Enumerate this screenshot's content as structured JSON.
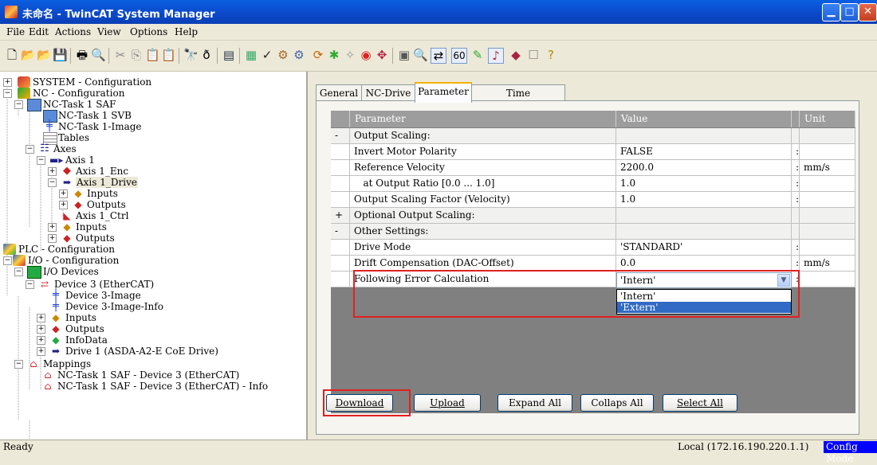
{
  "window": {
    "title": "未命名 - TwinCAT System Manager",
    "controls": {
      "minimize": "▁",
      "maximize": "□",
      "close": "✕"
    }
  },
  "menu": [
    "File",
    "Edit",
    "Actions",
    "View",
    "Options",
    "Help"
  ],
  "toolbar_icons": [
    "new-icon",
    "open-icon",
    "open-project-icon",
    "save-icon",
    "print-icon",
    "print-preview-icon",
    "cut-icon",
    "copy-icon",
    "paste-icon",
    "paste-with-links-icon",
    "find-icon",
    "replace-icon",
    "generate-mappings-icon",
    "check-configuration-icon",
    "activate-configuration-icon",
    "restart-run-mode-icon",
    "restart-config-mode-icon",
    "reload-devices-icon",
    "scan-devices-icon",
    "toggle-free-run-icon",
    "show-online-data-icon",
    "zoom-icon",
    "ams-router-icon",
    "io-trace-icon",
    "variable-icon",
    "ecat-icon",
    "project-icon",
    "help-icon"
  ],
  "tree": {
    "nodes": [
      {
        "label": "SYSTEM - Configuration"
      },
      {
        "label": "NC - Configuration"
      },
      {
        "label": "NC-Task 1 SAF"
      },
      {
        "label": "NC-Task 1 SVB"
      },
      {
        "label": "NC-Task 1-Image"
      },
      {
        "label": "Tables"
      },
      {
        "label": "Axes"
      },
      {
        "label": "Axis 1"
      },
      {
        "label": "Axis 1_Enc"
      },
      {
        "label": "Axis 1_Drive"
      },
      {
        "label": "Inputs"
      },
      {
        "label": "Outputs"
      },
      {
        "label": "Axis 1_Ctrl"
      },
      {
        "label": "Inputs"
      },
      {
        "label": "Outputs"
      },
      {
        "label": "PLC - Configuration"
      },
      {
        "label": "I/O - Configuration"
      },
      {
        "label": "I/O Devices"
      },
      {
        "label": "Device 3 (EtherCAT)"
      },
      {
        "label": "Device 3-Image"
      },
      {
        "label": "Device 3-Image-Info"
      },
      {
        "label": "Inputs"
      },
      {
        "label": "Outputs"
      },
      {
        "label": "InfoData"
      },
      {
        "label": "Drive 1 (ASDA-A2-E CoE Drive)"
      },
      {
        "label": "Mappings"
      },
      {
        "label": "NC-Task 1 SAF - Device 3 (EtherCAT)"
      },
      {
        "label": "NC-Task 1 SAF - Device 3 (EtherCAT) - Info"
      }
    ]
  },
  "tabs": [
    "General",
    "NC-Drive",
    "Parameter",
    "Time Compensation"
  ],
  "active_tab": "Parameter",
  "grid": {
    "headers": {
      "parameter": "Parameter",
      "value": "Value",
      "unit": "Unit"
    },
    "rows": [
      {
        "toggle": "-",
        "parameter": "Output Scaling:",
        "value": "",
        "unit": ""
      },
      {
        "toggle": "",
        "parameter": "Invert Motor Polarity",
        "value": "FALSE",
        "unit": ""
      },
      {
        "toggle": "",
        "parameter": "Reference Velocity",
        "value": "2200.0",
        "unit": "mm/s"
      },
      {
        "toggle": "",
        "parameter": "   at Output Ratio [0.0 ... 1.0]",
        "value": "1.0",
        "unit": ""
      },
      {
        "toggle": "",
        "parameter": "Output Scaling Factor (Velocity)",
        "value": "1.0",
        "unit": ""
      },
      {
        "toggle": "+",
        "parameter": "Optional Output Scaling:",
        "value": "",
        "unit": ""
      },
      {
        "toggle": "-",
        "parameter": "Other Settings:",
        "value": "",
        "unit": ""
      },
      {
        "toggle": "",
        "parameter": "Drive Mode",
        "value": "'STANDARD'",
        "unit": ""
      },
      {
        "toggle": "",
        "parameter": "Drift Compensation (DAC-Offset)",
        "value": "0.0",
        "unit": "mm/s"
      },
      {
        "toggle": "",
        "parameter": "Following Error Calculation",
        "value": "",
        "unit": ""
      }
    ],
    "combo": {
      "selected": "'Intern'",
      "options": [
        "'Intern'",
        "'Extern'"
      ],
      "highlighted": "'Extern'"
    }
  },
  "buttons": {
    "download": "Download",
    "upload": "Upload",
    "expand_all": "Expand All",
    "collapse_all": "Collaps All",
    "select_all": "Select All"
  },
  "status": {
    "left": "Ready",
    "address": "Local (172.16.190.220.1.1)",
    "mode": "Config Mode"
  }
}
